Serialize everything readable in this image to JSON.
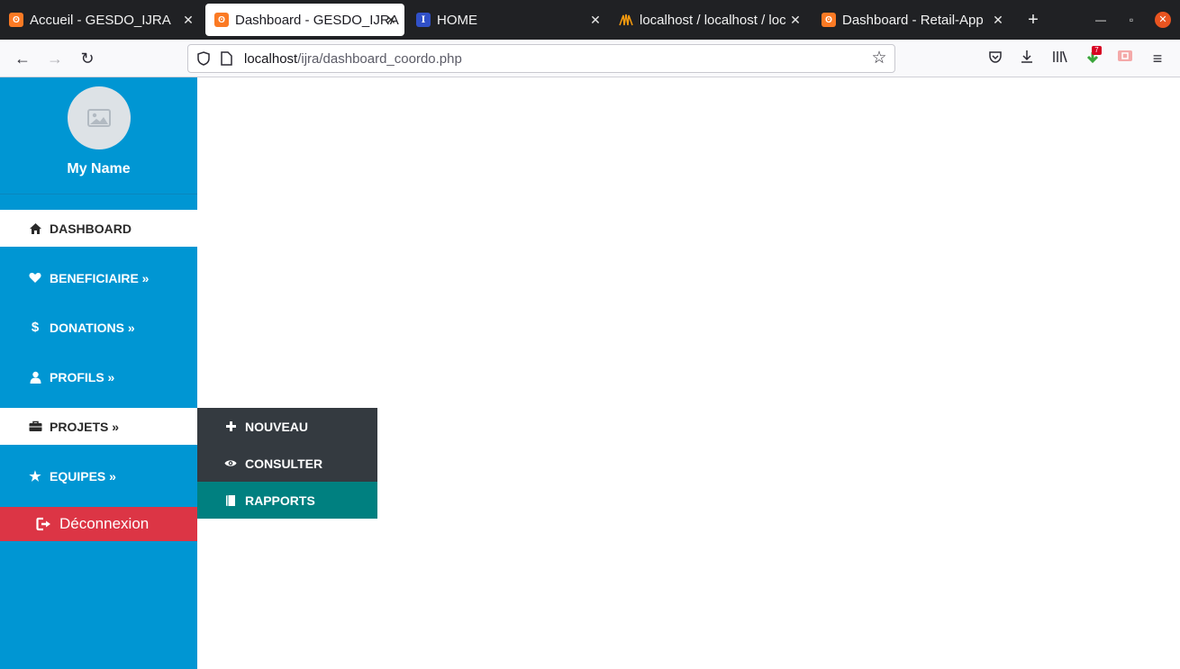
{
  "browser": {
    "tabs": [
      {
        "title": "Accueil - GESDO_IJRA",
        "favicon": "xampp-icon",
        "active": false
      },
      {
        "title": "Dashboard - GESDO_IJRA",
        "favicon": "xampp-icon",
        "active": true
      },
      {
        "title": "HOME",
        "favicon": "home-site-icon",
        "active": false
      },
      {
        "title": "localhost / localhost / loc",
        "favicon": "phpmyadmin-icon",
        "active": false
      },
      {
        "title": "Dashboard - Retail-App",
        "favicon": "xampp-icon",
        "active": false
      }
    ],
    "url_host": "localhost",
    "url_path": "/ijra/dashboard_coordo.php",
    "extension_badge": "7"
  },
  "sidebar": {
    "profile_name": "My Name",
    "items": [
      {
        "label": "DASHBOARD",
        "icon": "home-icon",
        "active": true
      },
      {
        "label": "BENEFICIAIRE »",
        "icon": "heart-icon"
      },
      {
        "label": "DONATIONS »",
        "icon": "dollar-icon"
      },
      {
        "label": "PROFILS »",
        "icon": "user-icon"
      },
      {
        "label": "PROJETS »",
        "icon": "briefcase-icon",
        "active": true
      },
      {
        "label": "EQUIPES »",
        "icon": "star-icon"
      }
    ],
    "logout_label": "Déconnexion"
  },
  "submenu": {
    "items": [
      {
        "label": "NOUVEAU",
        "icon": "plus-icon"
      },
      {
        "label": "CONSULTER",
        "icon": "eye-icon"
      },
      {
        "label": "RAPPORTS",
        "icon": "book-icon",
        "highlighted": true
      }
    ]
  },
  "colors": {
    "sidebar_bg": "#0096d3",
    "submenu_bg": "#343a40",
    "submenu_accent": "#008080",
    "logout_bg": "#dc3545"
  }
}
